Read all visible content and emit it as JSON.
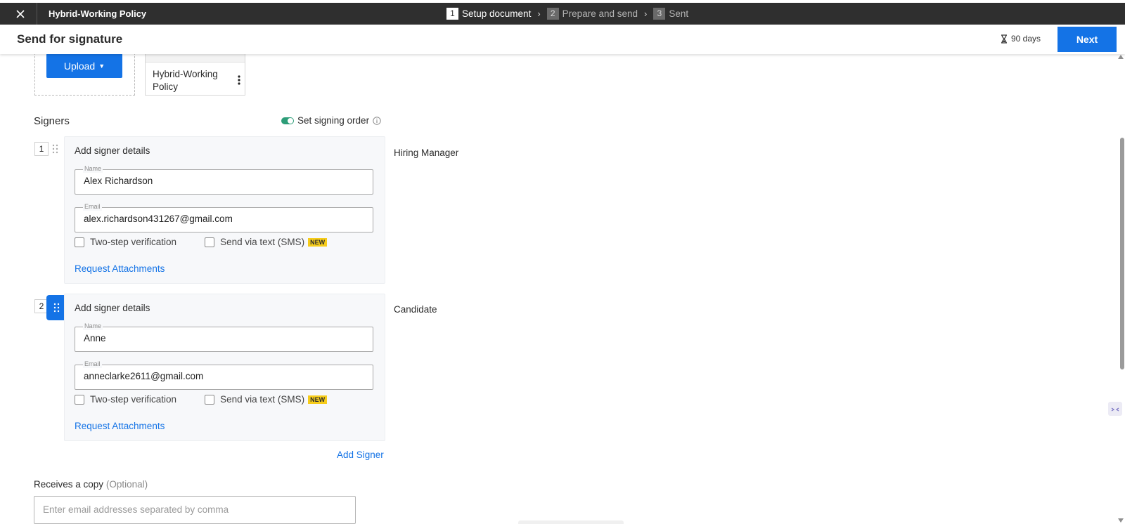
{
  "topbar": {
    "document_title": "Hybrid-Working Policy",
    "steps": [
      {
        "number": "1",
        "label": "Setup document"
      },
      {
        "number": "2",
        "label": "Prepare and send"
      },
      {
        "number": "3",
        "label": "Sent"
      }
    ],
    "active_step": 1
  },
  "header": {
    "title": "Send for signature",
    "expiry": "90 days",
    "next_label": "Next"
  },
  "upload": {
    "button_label": "Upload",
    "file_name": "Hybrid-Working Policy"
  },
  "signers_section": {
    "title": "Signers",
    "signing_order_label": "Set signing order",
    "signing_order_enabled": true,
    "signers": [
      {
        "number": "1",
        "heading": "Add signer details",
        "name_label": "Name",
        "name_value": "Alex Richardson",
        "email_label": "Email",
        "email_value": "alex.richardson431267@gmail.com",
        "two_step_label": "Two-step verification",
        "sms_label": "Send via text (SMS)",
        "new_badge": "NEW",
        "request_attachments": "Request Attachments",
        "role": "Hiring Manager"
      },
      {
        "number": "2",
        "heading": "Add signer details",
        "name_label": "Name",
        "name_value": "Anne",
        "email_label": "Email",
        "email_value": "anneclarke2611@gmail.com",
        "two_step_label": "Two-step verification",
        "sms_label": "Send via text (SMS)",
        "new_badge": "NEW",
        "request_attachments": "Request Attachments",
        "role": "Candidate"
      }
    ],
    "add_signer_label": "Add Signer"
  },
  "copy_section": {
    "label": "Receives a copy",
    "optional_label": "(Optional)",
    "placeholder": "Enter email addresses separated by comma"
  },
  "colors": {
    "accent": "#1473e6",
    "topbar": "#2f2f2f",
    "toggle_on": "#2d9d78",
    "badge": "#f6cc1a"
  }
}
